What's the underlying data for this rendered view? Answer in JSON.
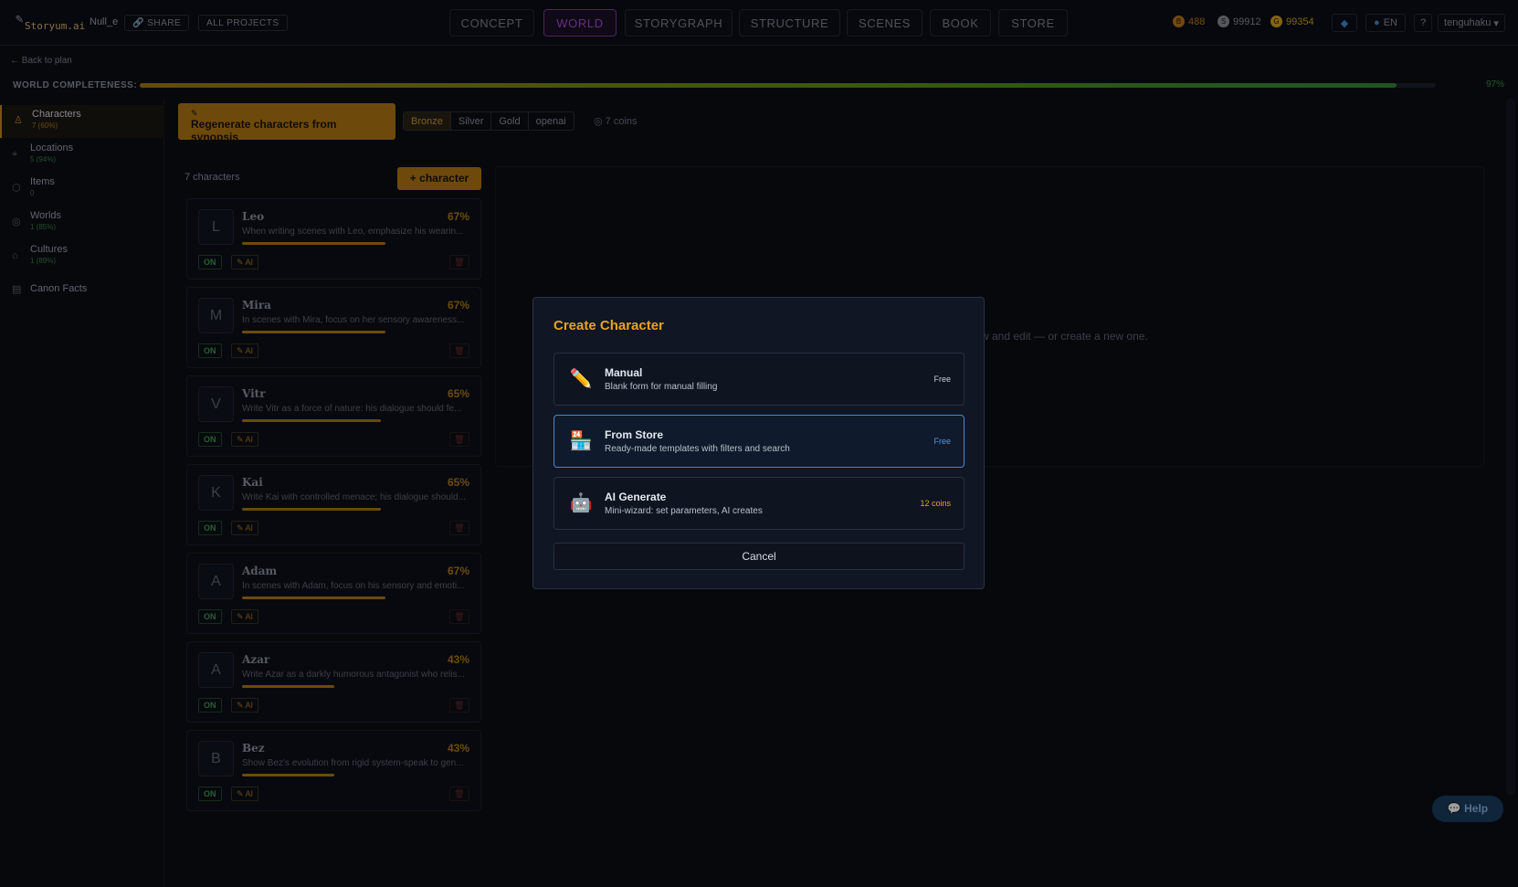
{
  "header": {
    "logo_text": "Storyum.ai",
    "project_name": "Null_e",
    "share_label": "SHARE",
    "all_projects_label": "ALL PROJECTS",
    "tabs": [
      {
        "label": "CONCEPT"
      },
      {
        "label": "WORLD",
        "active": true
      },
      {
        "label": "STORYGRAPH"
      },
      {
        "label": "STRUCTURE"
      },
      {
        "label": "SCENES"
      },
      {
        "label": "BOOK"
      },
      {
        "label": "STORE"
      }
    ],
    "balances": [
      {
        "value": "488",
        "color": "#b87818"
      },
      {
        "value": "99912",
        "color": "#8a8f99"
      },
      {
        "value": "99354",
        "color": "#d4a21c"
      }
    ],
    "language": "EN",
    "help_symbol": "?",
    "username": "tenguhaku"
  },
  "subbar": {
    "back_label": "← Back to plan",
    "completeness_label": "WORLD COMPLETENESS:",
    "completeness_pct": 0.97,
    "completeness_text": "97%"
  },
  "sidebar": {
    "items": [
      {
        "label": "Characters",
        "sub": "7 (60%)",
        "icon": "person-icon",
        "active": true
      },
      {
        "label": "Locations",
        "sub": "5 (94%)",
        "icon": "pin-icon"
      },
      {
        "label": "Items",
        "sub": "0",
        "icon": "box-icon"
      },
      {
        "label": "Worlds",
        "sub": "1 (85%)",
        "icon": "globe-icon"
      },
      {
        "label": "Cultures",
        "sub": "1 (89%)",
        "icon": "building-icon"
      },
      {
        "label": "Canon Facts",
        "sub": "",
        "icon": "document-icon"
      }
    ]
  },
  "toolbar": {
    "regen_icon": "✎",
    "regen_label": "Regenerate characters from synopsis",
    "tiers": [
      "Bronze",
      "Silver",
      "Gold",
      "openai"
    ],
    "cost_label": "◎ 7 coins"
  },
  "list": {
    "count_label": "7 characters",
    "add_label": "+ character",
    "characters": [
      {
        "initial": "L",
        "name": "Leo",
        "pct": "67%",
        "progress": 0.67,
        "desc": "When writing scenes with Leo, emphasize his wearin..."
      },
      {
        "initial": "M",
        "name": "Mira",
        "pct": "67%",
        "progress": 0.67,
        "desc": "In scenes with Mira, focus on her sensory awareness..."
      },
      {
        "initial": "V",
        "name": "Vitr",
        "pct": "65%",
        "progress": 0.65,
        "desc": "Write Vitr as a force of nature: his dialogue should fe..."
      },
      {
        "initial": "K",
        "name": "Kai",
        "pct": "65%",
        "progress": 0.65,
        "desc": "Write Kai with controlled menace; his dialogue should..."
      },
      {
        "initial": "A",
        "name": "Adam",
        "pct": "67%",
        "progress": 0.67,
        "desc": "In scenes with Adam, focus on his sensory and emoti..."
      },
      {
        "initial": "A",
        "name": "Azar",
        "pct": "43%",
        "progress": 0.43,
        "desc": "Write Azar as a darkly humorous antagonist who relis..."
      },
      {
        "initial": "B",
        "name": "Bez",
        "pct": "43%",
        "progress": 0.43,
        "desc": "Show Bez's evolution from rigid system-speak to gen..."
      }
    ],
    "on_label": "ON",
    "ai_label": "✎ AI"
  },
  "empty_panel": {
    "text": "w and edit — or create a new one."
  },
  "help_button": "💬 Help",
  "modal": {
    "title": "Create Character",
    "options": [
      {
        "icon": "pencil-icon",
        "glyph": "✏️",
        "title": "Manual",
        "subtitle": "Blank form for manual filling",
        "price": "Free"
      },
      {
        "icon": "store-icon",
        "glyph": "🏪",
        "title": "From Store",
        "subtitle": "Ready-made templates with filters and search",
        "price": "Free",
        "selected": true
      },
      {
        "icon": "robot-icon",
        "glyph": "🤖",
        "title": "AI Generate",
        "subtitle": "Mini-wizard: set parameters, AI creates",
        "price": "12 coins"
      }
    ],
    "cancel_label": "Cancel"
  },
  "colors": {
    "accent": "#e8a324",
    "active_tab": "#a24dd0",
    "progress_ok": "#2e8a3a",
    "selection_border": "#4a86c8"
  }
}
